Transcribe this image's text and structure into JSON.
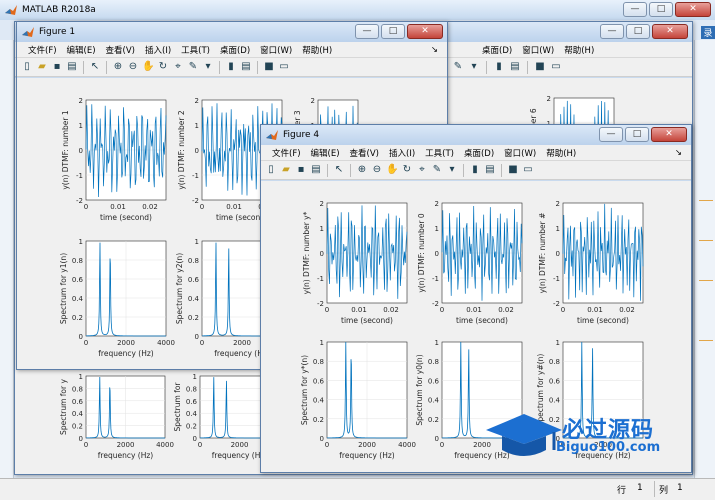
{
  "main": {
    "title": "MATLAB R2018a",
    "side_label": "录"
  },
  "menu": [
    "文件(F)",
    "编辑(E)",
    "查看(V)",
    "插入(I)",
    "工具(T)",
    "桌面(D)",
    "窗口(W)",
    "帮助(H)"
  ],
  "back_menu": [
    "桌面(D)",
    "窗口(W)",
    "帮助(H)"
  ],
  "windows": {
    "min": "—",
    "max": "□",
    "close": "✕"
  },
  "toolbar_icons": [
    "new-file-icon",
    "open-folder-icon",
    "save-icon",
    "print-icon",
    "pointer-icon",
    "zoom-in-icon",
    "zoom-out-icon",
    "pan-icon",
    "rotate-icon",
    "data-cursor-icon",
    "brush-icon",
    "link-icon",
    "colorbar-icon",
    "legend-icon",
    "grid-off-icon",
    "plot-tools-icon"
  ],
  "figure1": {
    "title": "Figure 1",
    "time_plots": [
      {
        "ylabel": "y(n) DTMF: number 1"
      },
      {
        "ylabel": "y(n) DTMF: number 2"
      },
      {
        "ylabel": "y(n) DTMF: number 3"
      }
    ],
    "spec_plots": [
      {
        "ylabel": "Spectrum for y1(n)"
      },
      {
        "ylabel": "Spectrum for y2(n)"
      }
    ],
    "time_xlabel": "time (second)",
    "freq_xlabel": "frequency (Hz)"
  },
  "figure_back": {
    "right_label": "y(n) DTMF: number 6",
    "spec_plots": [
      {
        "ylabel": "Spectrum for y"
      },
      {
        "ylabel": "Spectrum for"
      }
    ],
    "freq_xlabel": "frequency (Hz)"
  },
  "figure4": {
    "title": "Figure 4",
    "time_plots": [
      {
        "ylabel": "y(n) DTMF: number y*"
      },
      {
        "ylabel": "y(n) DTMF: number 0"
      },
      {
        "ylabel": "y(n) DTMF: number #"
      }
    ],
    "spec_plots": [
      {
        "ylabel": "Spectrum for y*(n)"
      },
      {
        "ylabel": "Spectrum for y0(n)"
      },
      {
        "ylabel": "Spectrum for y#(n)"
      }
    ],
    "time_xlabel": "time (second)",
    "freq_xlabel": "frequency (Hz)"
  },
  "axes": {
    "time_yticks": [
      "2",
      "1",
      "0",
      "-1",
      "-2"
    ],
    "time_xticks": [
      "0",
      "0.01",
      "0.02"
    ],
    "spec_yticks": [
      "1",
      "0.8",
      "0.6",
      "0.4",
      "0.2",
      "0"
    ],
    "spec_xticks": [
      "0",
      "2000",
      "4000"
    ],
    "spec_xticks_short": [
      "0",
      "2000"
    ]
  },
  "watermark": {
    "cn": "必过源码",
    "en": "Biguo100.com"
  },
  "status": {
    "row_label": "行",
    "row": "1",
    "col_label": "列",
    "col": "1"
  },
  "colors": {
    "line": "#0072bd",
    "grid": "#e2e2e2",
    "title_bar": "#c5d9ef"
  }
}
